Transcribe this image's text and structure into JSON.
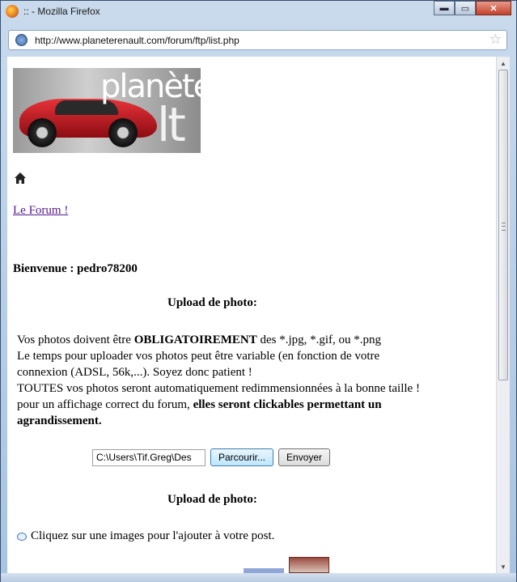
{
  "window": {
    "title": ":: - Mozilla Firefox",
    "minimize_label": "▬",
    "maximize_label": "▭",
    "close_label": "✕"
  },
  "urlbar": {
    "url": "http://www.planeterenault.com/forum/ftp/list.php"
  },
  "page": {
    "banner": {
      "text_top": "planète",
      "text_bottom": "lt"
    },
    "forum_link": "Le Forum !",
    "welcome": "Bienvenue : pedro78200",
    "upload_heading": "Upload de photo:",
    "info": {
      "line1_pre": "Vos photos doivent être ",
      "line1_bold": "OBLIGATOIREMENT",
      "line1_post": " des *.jpg, *.gif, ou *.png",
      "line2": "Le temps pour uploader vos photos peut être variable (en fonction de votre connexion (ADSL, 56k,...). Soyez donc patient !",
      "line3_pre": "TOUTES vos photos seront automatiquement redimmensionnées à la bonne taille ! pour un affichage correct du forum, ",
      "line3_bold": "elles seront clickables permettant un agrandissement."
    },
    "file_input_value": "C:\\Users\\Tif.Greg\\Des",
    "browse_button": "Parcourir...",
    "send_button": "Envoyer",
    "upload_heading_2": "Upload de photo:",
    "tip": "Cliquez sur une images pour l'ajouter à votre post."
  },
  "colors": {
    "link": "#551a8b",
    "chrome": "#a9c3df"
  }
}
